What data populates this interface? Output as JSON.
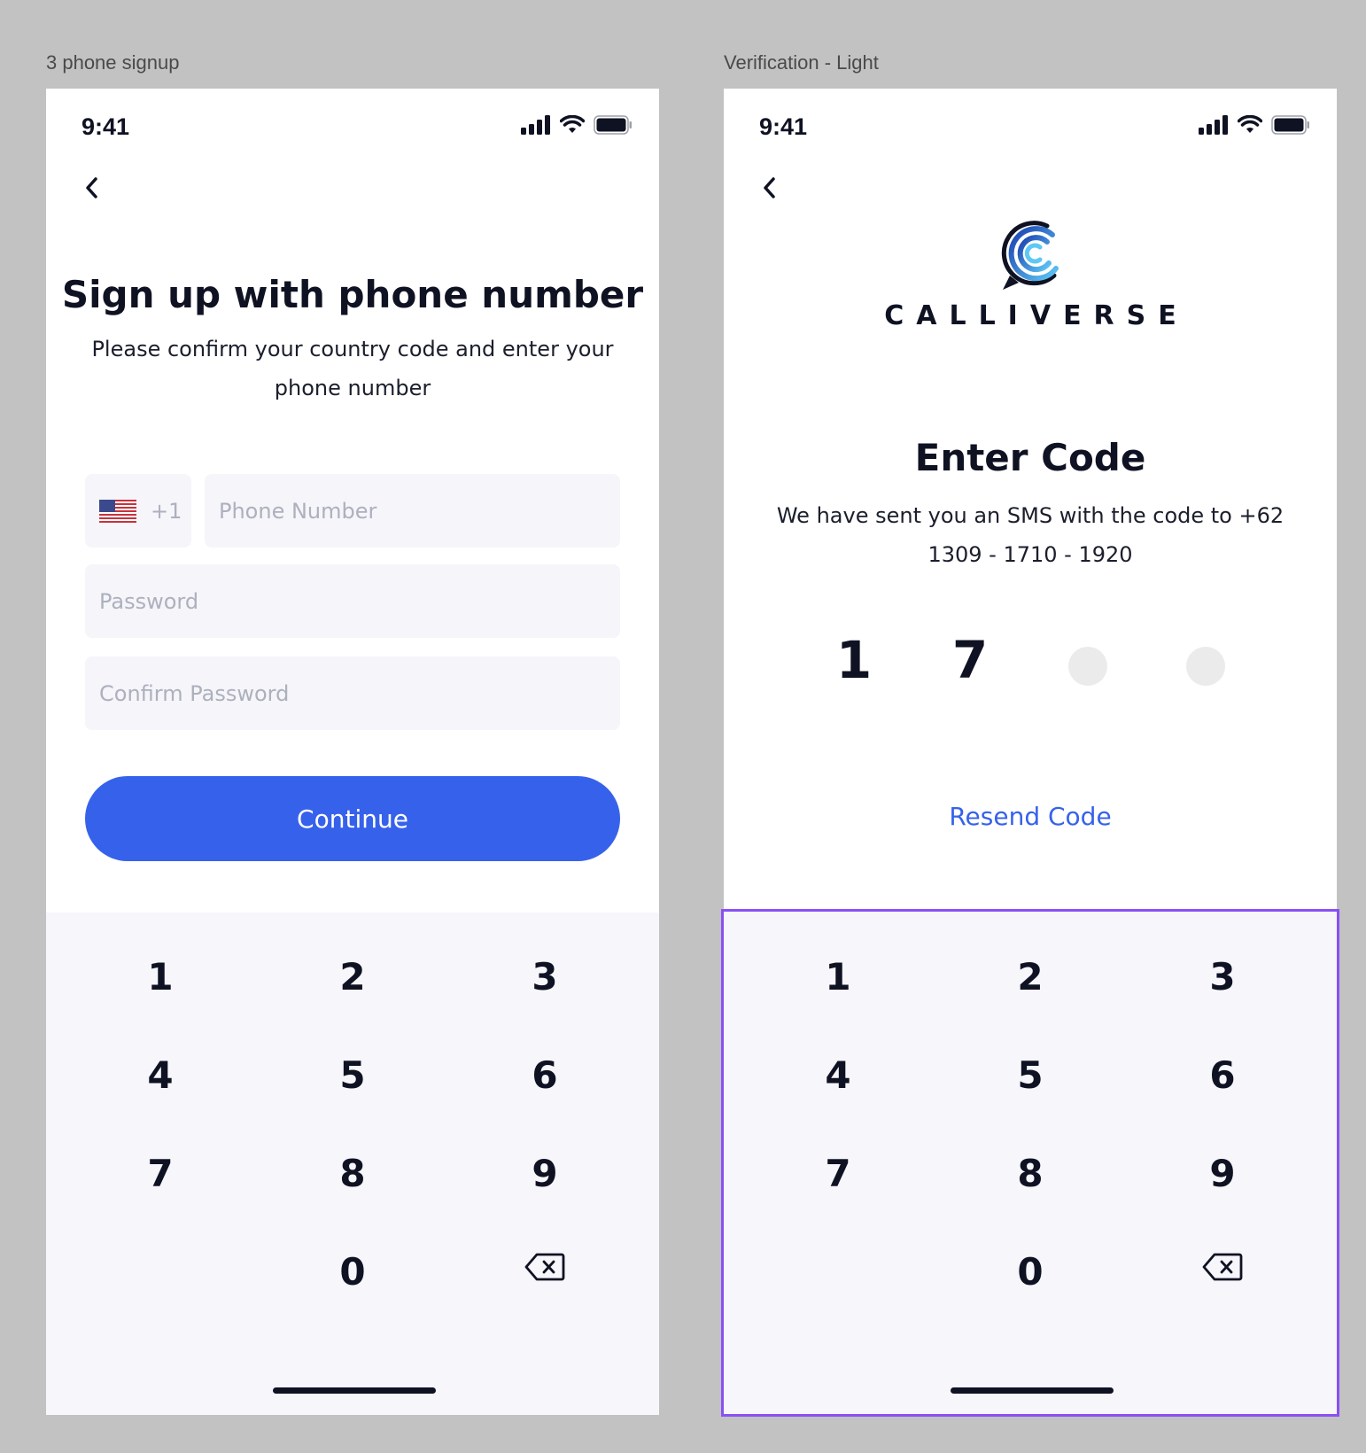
{
  "frames": {
    "left_label": "3 phone signup",
    "right_label": "Verification - Light"
  },
  "status_bar": {
    "time": "9:41"
  },
  "signup": {
    "title": "Sign up with phone number",
    "subtitle": "Please confirm your country code and enter your phone number",
    "country_code": "+1",
    "country_flag": "us-flag-icon",
    "phone_placeholder": "Phone Number",
    "password_placeholder": "Password",
    "confirm_password_placeholder": "Confirm Password",
    "continue_label": "Continue"
  },
  "verification": {
    "logo_text": "CALLIVERSE",
    "title": "Enter Code",
    "subtitle": "We have sent you an SMS with the code to +62 1309 - 1710 - 1920",
    "code_digits": [
      "1",
      "7",
      "",
      ""
    ],
    "resend_label": "Resend Code"
  },
  "keypad": {
    "keys": [
      "1",
      "2",
      "3",
      "4",
      "5",
      "6",
      "7",
      "8",
      "9",
      "",
      "0",
      "backspace-icon"
    ]
  },
  "colors": {
    "primary": "#3662eb",
    "field_bg": "#f5f5fa",
    "keypad_bg": "#f6f6fb",
    "selection": "#8a4ff5",
    "text": "#0f1222"
  }
}
